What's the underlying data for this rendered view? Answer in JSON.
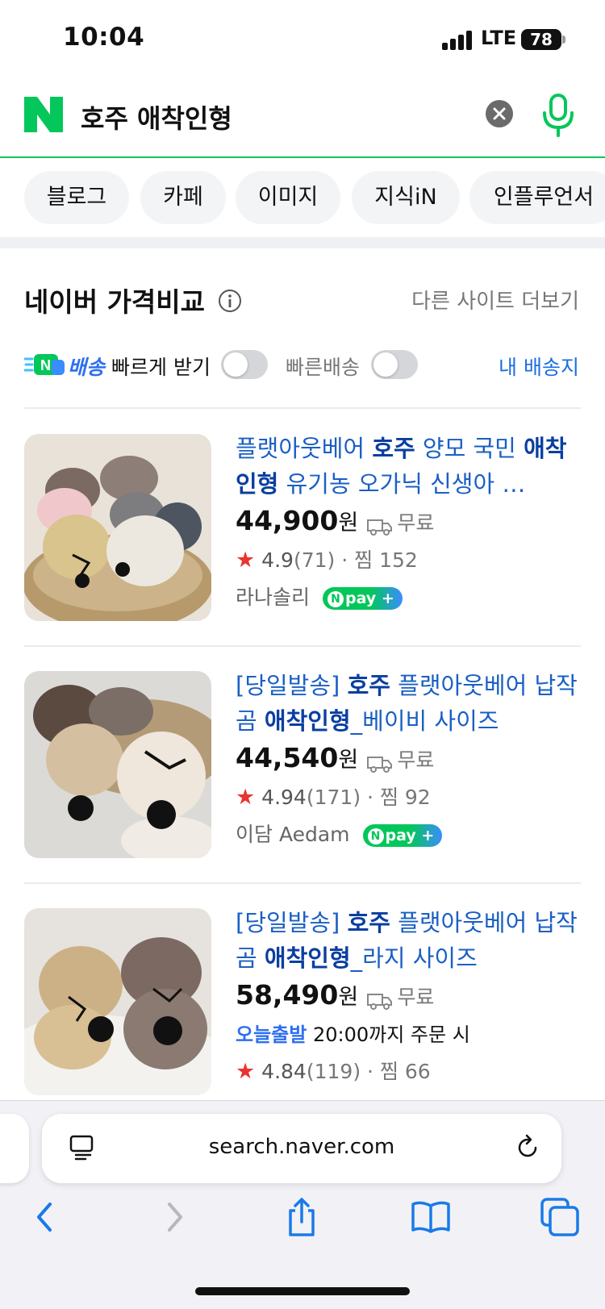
{
  "status_bar": {
    "time": "10:04",
    "network": "LTE",
    "battery": "78"
  },
  "search": {
    "query": "호주 애착인형"
  },
  "tabs": [
    {
      "label": "블로그"
    },
    {
      "label": "카페"
    },
    {
      "label": "이미지"
    },
    {
      "label": "지식iN"
    },
    {
      "label": "인플루언서"
    }
  ],
  "section": {
    "title": "네이버 가격비교",
    "more_link": "다른 사이트 더보기"
  },
  "filters": {
    "npay_delivery_brand": "배송",
    "fast_receive_label": "빠르게 받기",
    "fast_delivery_label": "빠른배송",
    "my_address_link": "내 배송지"
  },
  "products": [
    {
      "title_parts": [
        "플랫아웃베어 ",
        "호주",
        " 양모 국민 ",
        "애착 인형",
        " 유기농 오가닉 신생아 …"
      ],
      "price": "44,900",
      "currency": "원",
      "shipping": "무료",
      "rating": "4.9",
      "reviews": "(71)",
      "wishlist": "찜 152",
      "seller": "라나솔리",
      "npay_label": "pay"
    },
    {
      "title_parts": [
        "[당일발송] ",
        "호주",
        " 플랫아웃베어 납작곰 ",
        "애착인형",
        "_베이비 사이즈"
      ],
      "price": "44,540",
      "currency": "원",
      "shipping": "무료",
      "rating": "4.94",
      "reviews": "(171)",
      "wishlist": "찜 92",
      "seller": "이담 Aedam",
      "npay_label": "pay"
    },
    {
      "title_parts": [
        "[당일발송] ",
        "호주",
        " 플랫아웃베어 납작곰 ",
        "애착인형",
        "_라지 사이즈"
      ],
      "price": "58,490",
      "currency": "원",
      "shipping": "무료",
      "delivery_tag": "오늘출발",
      "delivery_text": "20:00까지 주문 시",
      "rating": "4.84",
      "reviews": "(119)",
      "wishlist": "찜 66"
    }
  ],
  "browser": {
    "url": "search.naver.com"
  },
  "colors": {
    "naver_green": "#03c75a",
    "link_blue": "#1a5fc4",
    "accent_blue": "#2d6ff0",
    "star_red": "#e9342f"
  },
  "icons": [
    "naver-logo-icon",
    "clear-icon",
    "mic-icon",
    "info-icon",
    "truck-icon",
    "star-icon",
    "reader-icon",
    "reload-icon",
    "back-icon",
    "forward-icon",
    "share-icon",
    "bookmarks-icon",
    "tabs-icon"
  ]
}
